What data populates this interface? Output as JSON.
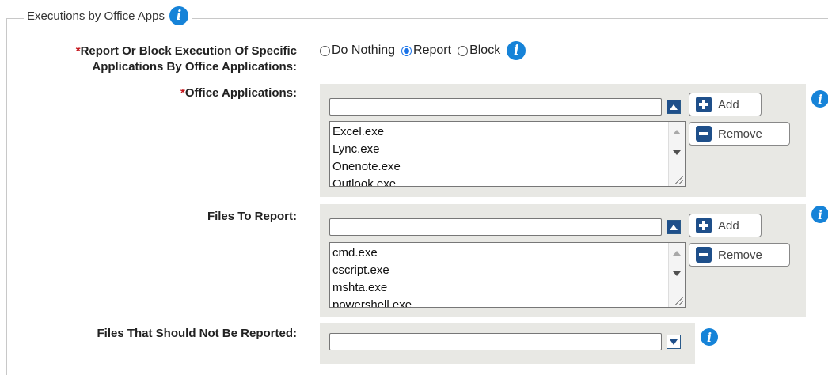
{
  "section": {
    "title": "Executions by Office Apps"
  },
  "report_block": {
    "required_mark": "*",
    "label_line1": "Report Or Block Execution Of Specific",
    "label_line2": "Applications By Office Applications:",
    "options": [
      {
        "label": "Do Nothing",
        "checked": false
      },
      {
        "label": "Report",
        "checked": true
      },
      {
        "label": "Block",
        "checked": false
      }
    ]
  },
  "office_apps": {
    "required_mark": "*",
    "label": "Office Applications:",
    "input_value": "",
    "items": [
      "Excel.exe",
      "Lync.exe",
      "Onenote.exe",
      "Outlook.exe"
    ],
    "add_label": "Add",
    "remove_label": "Remove"
  },
  "files_to_report": {
    "label": "Files To Report:",
    "input_value": "",
    "items": [
      "cmd.exe",
      "cscript.exe",
      "mshta.exe",
      "powershell.exe"
    ],
    "add_label": "Add",
    "remove_label": "Remove"
  },
  "files_not_reported": {
    "label": "Files That Should Not Be Reported:",
    "input_value": ""
  },
  "colors": {
    "info_icon": "#1683d8",
    "button_icon": "#1e4f8a",
    "required": "#c4161c",
    "panel_bg": "#e8e8e4"
  },
  "icons": {
    "info": "info-icon",
    "add": "plus-icon",
    "remove": "minus-icon",
    "expand": "chevron-up-icon",
    "collapse": "chevron-down-icon"
  }
}
